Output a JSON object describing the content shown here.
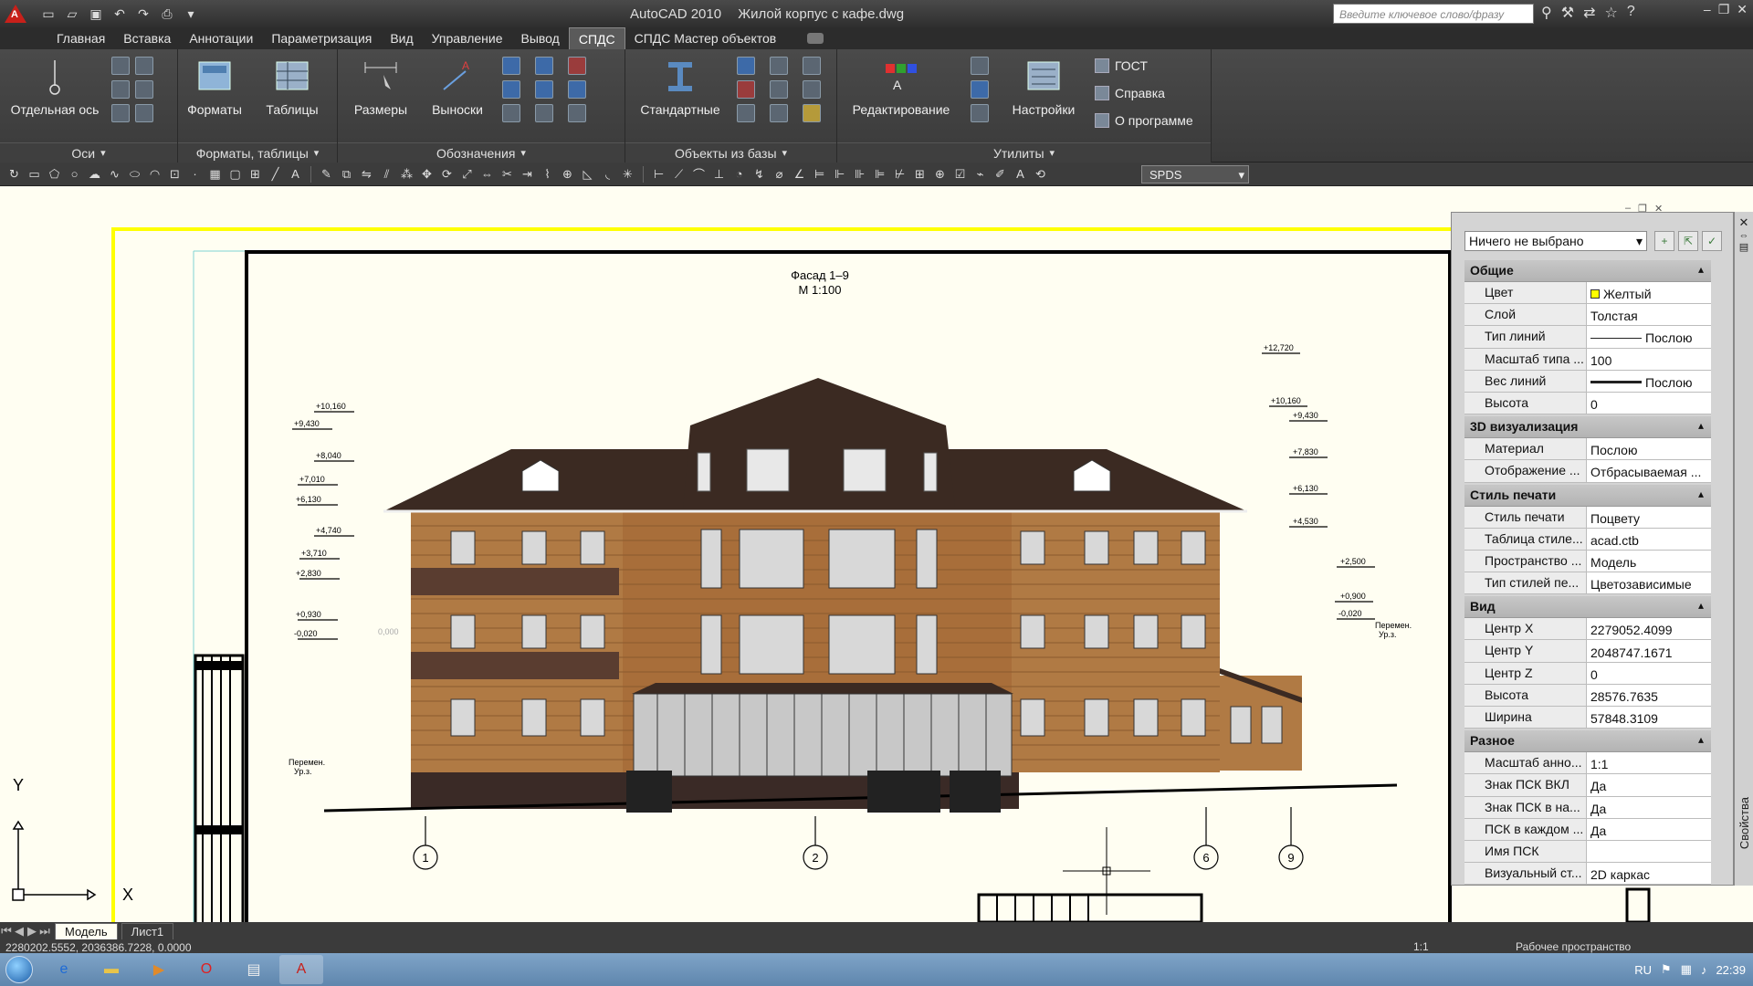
{
  "window": {
    "app_title": "AutoCAD 2010",
    "file_title": "Жилой корпус с кафе.dwg",
    "search_placeholder": "Введите ключевое слово/фразу"
  },
  "tabs": [
    "Главная",
    "Вставка",
    "Аннотации",
    "Параметризация",
    "Вид",
    "Управление",
    "Вывод",
    "СПДС",
    "СПДС Мастер объектов"
  ],
  "active_tab": "СПДС",
  "ribbon": {
    "panels": [
      "Оси",
      "Форматы, таблицы",
      "Обозначения",
      "Объекты из базы",
      "Утилиты"
    ],
    "buttons": {
      "axis": "Отдельная ось",
      "formats": "Форматы",
      "tables": "Таблицы",
      "dimensions": "Размеры",
      "leaders": "Выноски",
      "standard": "Стандартные",
      "editing": "Редактирование",
      "settings": "Настройки",
      "gost": "ГОСТ",
      "help": "Справка",
      "about": "О программе"
    }
  },
  "toolbar": {
    "spds_value": "SPDS"
  },
  "drawing": {
    "title_line1": "Фасад 1–9",
    "title_line2": "М 1:100",
    "left_marks": [
      "+10,160",
      "+9,430",
      "+8,040",
      "+7,010",
      "+6,130",
      "+4,740",
      "+3,710",
      "+2,830",
      "+0,930",
      "-0,020"
    ],
    "right_marks": [
      "+12,720",
      "+10,160",
      "+9,430",
      "+7,830",
      "+6,130",
      "+4,530",
      "+2,500",
      "+0,900",
      "-0,020"
    ],
    "zero_mark": "0,000",
    "ground_label1": "Перемен.",
    "ground_label2": "Ур.з.",
    "axes": [
      "1",
      "2",
      "6",
      "9"
    ],
    "ucs_x": "X",
    "ucs_y": "Y"
  },
  "properties": {
    "selection": "Ничего не выбрано",
    "side_label": "Свойства",
    "sections": [
      {
        "title": "Общие",
        "rows": [
          {
            "key": "Цвет",
            "value": "Желтый"
          },
          {
            "key": "Слой",
            "value": "Толстая"
          },
          {
            "key": "Тип линий",
            "value": "Послою"
          },
          {
            "key": "Масштаб типа ...",
            "value": "100"
          },
          {
            "key": "Вес линий",
            "value": "Послою"
          },
          {
            "key": "Высота",
            "value": "0"
          }
        ]
      },
      {
        "title": "3D визуализация",
        "rows": [
          {
            "key": "Материал",
            "value": "Послою"
          },
          {
            "key": "Отображение ...",
            "value": "Отбрасываемая ..."
          }
        ]
      },
      {
        "title": "Стиль печати",
        "rows": [
          {
            "key": "Стиль печати",
            "value": "Поцвету"
          },
          {
            "key": "Таблица стиле...",
            "value": "acad.ctb"
          },
          {
            "key": "Пространство ...",
            "value": "Модель"
          },
          {
            "key": "Тип стилей пе...",
            "value": "Цветозависимые"
          }
        ]
      },
      {
        "title": "Вид",
        "rows": [
          {
            "key": "Центр X",
            "value": "2279052.4099"
          },
          {
            "key": "Центр Y",
            "value": "2048747.1671"
          },
          {
            "key": "Центр Z",
            "value": "0"
          },
          {
            "key": "Высота",
            "value": "28576.7635"
          },
          {
            "key": "Ширина",
            "value": "57848.3109"
          }
        ]
      },
      {
        "title": "Разное",
        "rows": [
          {
            "key": "Масштаб анно...",
            "value": "1:1"
          },
          {
            "key": "Знак ПСК ВКЛ",
            "value": "Да"
          },
          {
            "key": "Знак ПСК в на...",
            "value": "Да"
          },
          {
            "key": "ПСК в каждом ...",
            "value": "Да"
          },
          {
            "key": "Имя ПСК",
            "value": ""
          },
          {
            "key": "Визуальный ст...",
            "value": "2D каркас"
          }
        ]
      }
    ]
  },
  "layout_tabs": [
    "Модель",
    "Лист1"
  ],
  "status": {
    "coords": "2280202.5552, 2036386.7228, 0.0000",
    "workspace": "Рабочее пространство",
    "scale": "1:1"
  },
  "tray": {
    "lang": "RU",
    "time": "22:39"
  },
  "colors": {
    "accent_red": "#c8201a",
    "facade": "#b07a44",
    "roof": "#3b2a22",
    "frame_yellow": "#ffff00"
  }
}
